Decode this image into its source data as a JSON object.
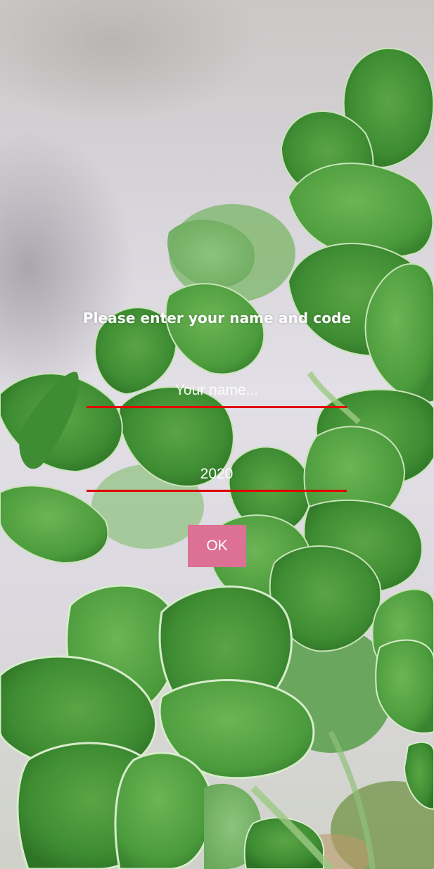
{
  "form": {
    "title": "Please enter your name and code",
    "name_placeholder": "Your name...",
    "name_value": "",
    "code_value": "2020",
    "ok_label": "OK"
  },
  "colors": {
    "underline": "#e00000",
    "button": "#dc7095",
    "text": "#ffffff"
  }
}
